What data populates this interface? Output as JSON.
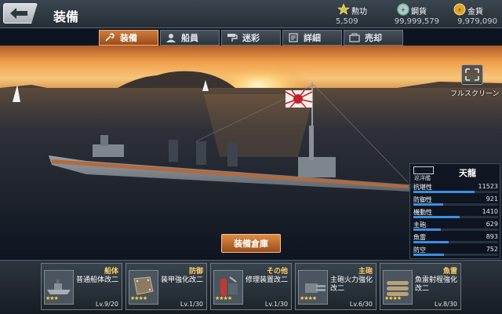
{
  "header": {
    "title": "装備",
    "currencies": [
      {
        "label": "勲功",
        "value": "5,509",
        "icon": "star-medal-icon",
        "color": "#d8c23a"
      },
      {
        "label": "鋼貨",
        "value": "99,999,579",
        "icon": "steel-coin-icon",
        "color": "#55c08a"
      },
      {
        "label": "金貨",
        "value": "9,979,090",
        "icon": "gold-coin-icon",
        "color": "#e0a52b"
      }
    ]
  },
  "tabs": [
    {
      "label": "装備",
      "icon": "wrench-icon",
      "active": true
    },
    {
      "label": "船員",
      "icon": "crew-icon",
      "active": false
    },
    {
      "label": "迷彩",
      "icon": "paint-roller-icon",
      "active": false
    },
    {
      "label": "詳細",
      "icon": "document-icon",
      "active": false
    },
    {
      "label": "売却",
      "icon": "sell-icon",
      "active": false
    }
  ],
  "fullscreen": {
    "label": "フルスクリーン"
  },
  "ship": {
    "class": "巡洋艦",
    "name": "天龍",
    "stats": [
      {
        "label": "抗堪性",
        "value": "11523",
        "level": 0.72
      },
      {
        "label": "防御性",
        "value": "921",
        "level": 0.35
      },
      {
        "label": "機動性",
        "value": "1410",
        "level": 0.55
      },
      {
        "label": "主砲",
        "value": "629",
        "level": 0.32
      },
      {
        "label": "魚雷",
        "value": "893",
        "level": 0.42
      },
      {
        "label": "防空",
        "value": "752",
        "level": 0.36
      }
    ]
  },
  "warehouse_label": "装備倉庫",
  "slots": [
    {
      "category": "船体",
      "name": "普通船体改二",
      "stars": "★★★",
      "level": "Lv.9/20",
      "icon": "hull-icon"
    },
    {
      "category": "防御",
      "name": "装甲強化改二",
      "stars": "★★★★",
      "level": "Lv.1/30",
      "icon": "armor-plate-icon"
    },
    {
      "category": "その他",
      "name": "修理装置改二",
      "stars": "★★★★",
      "level": "Lv.1/30",
      "icon": "repair-kit-icon"
    },
    {
      "category": "主砲",
      "name": "主砲火力強化改二",
      "stars": "★★★★",
      "level": "Lv.6/30",
      "icon": "main-gun-icon"
    },
    {
      "category": "魚雷",
      "name": "魚雷射程強化改二",
      "stars": "★★★★",
      "level": "Lv.8/30",
      "icon": "torpedo-icon"
    }
  ]
}
